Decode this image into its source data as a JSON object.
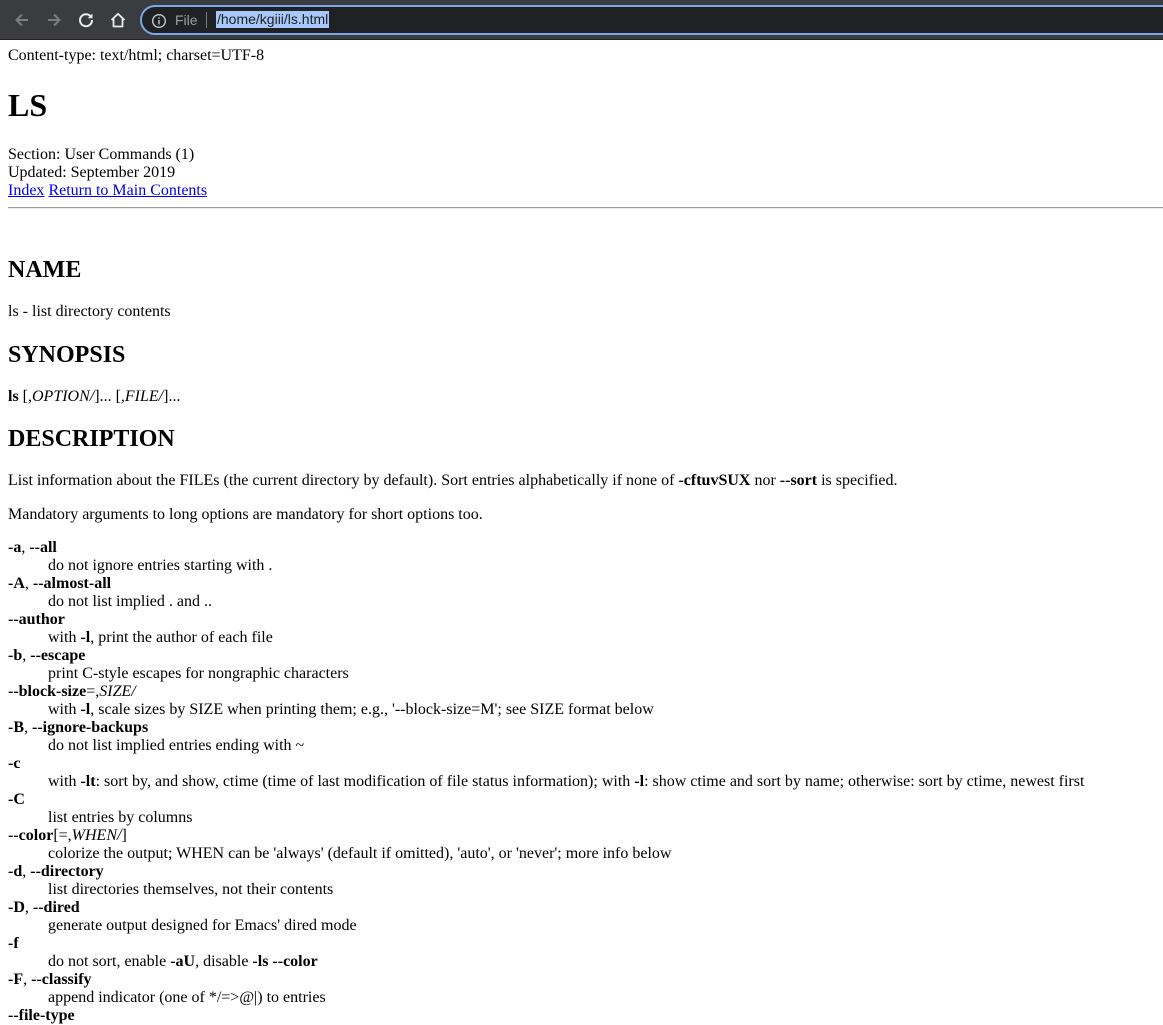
{
  "browser": {
    "back_icon": "arrow-left-icon",
    "forward_icon": "arrow-right-icon",
    "reload_icon": "reload-icon",
    "home_icon": "home-icon",
    "info_icon": "info-icon",
    "scheme_label": "File",
    "url": "/home/kgiii/ls.html",
    "colors": {
      "toolbar": "#3b3c3f",
      "omnibox_border": "#7ba7e8",
      "selection": "#a8c7fa"
    }
  },
  "doc": {
    "content_type": "Content-type: text/html; charset=UTF-8",
    "title": "LS",
    "section": "Section: User Commands (1)",
    "updated": "Updated: September 2019",
    "index_link": "Index",
    "main_link": "Return to Main Contents",
    "name_heading": "NAME",
    "name_text": "ls - list directory contents",
    "synopsis_heading": "SYNOPSIS",
    "synopsis": {
      "cmd": "ls",
      "p1": " [,",
      "opt": "OPTION/",
      "p2": "]... [,",
      "file": "FILE/",
      "p3": "]..."
    },
    "description_heading": "DESCRIPTION",
    "desc1": {
      "a": "List information about the FILEs (the current directory by default). Sort entries alphabetically if none of ",
      "b1": "-cftuvSUX",
      "c": " nor ",
      "b2": "--sort",
      "d": " is specified."
    },
    "desc2": "Mandatory arguments to long options are mandatory for short options too.",
    "options": [
      {
        "term": [
          [
            "b",
            "-a"
          ],
          [
            "t",
            ", "
          ],
          [
            "b",
            "--all"
          ]
        ],
        "desc": [
          [
            "t",
            "do not ignore entries starting with ."
          ]
        ]
      },
      {
        "term": [
          [
            "b",
            "-A"
          ],
          [
            "t",
            ", "
          ],
          [
            "b",
            "--almost-all"
          ]
        ],
        "desc": [
          [
            "t",
            "do not list implied . and .."
          ]
        ]
      },
      {
        "term": [
          [
            "b",
            "--author"
          ]
        ],
        "desc": [
          [
            "t",
            "with "
          ],
          [
            "b",
            "-l"
          ],
          [
            "t",
            ", print the author of each file"
          ]
        ]
      },
      {
        "term": [
          [
            "b",
            "-b"
          ],
          [
            "t",
            ", "
          ],
          [
            "b",
            "--escape"
          ]
        ],
        "desc": [
          [
            "t",
            "print C-style escapes for nongraphic characters"
          ]
        ]
      },
      {
        "term": [
          [
            "b",
            "--block-size"
          ],
          [
            "t",
            "=,"
          ],
          [
            "i",
            "SIZE/"
          ]
        ],
        "desc": [
          [
            "t",
            "with "
          ],
          [
            "b",
            "-l"
          ],
          [
            "t",
            ", scale sizes by SIZE when printing them; e.g., '--block-size=M'; see SIZE format below"
          ]
        ]
      },
      {
        "term": [
          [
            "b",
            "-B"
          ],
          [
            "t",
            ", "
          ],
          [
            "b",
            "--ignore-backups"
          ]
        ],
        "desc": [
          [
            "t",
            "do not list implied entries ending with ~"
          ]
        ]
      },
      {
        "term": [
          [
            "b",
            "-c"
          ]
        ],
        "desc": [
          [
            "t",
            "with "
          ],
          [
            "b",
            "-lt"
          ],
          [
            "t",
            ": sort by, and show, ctime (time of last modification of file status information); with "
          ],
          [
            "b",
            "-l"
          ],
          [
            "t",
            ": show ctime and sort by name; otherwise: sort by ctime, newest first"
          ]
        ]
      },
      {
        "term": [
          [
            "b",
            "-C"
          ]
        ],
        "desc": [
          [
            "t",
            "list entries by columns"
          ]
        ]
      },
      {
        "term": [
          [
            "b",
            "--color"
          ],
          [
            "t",
            "[=,"
          ],
          [
            "i",
            "WHEN/"
          ],
          [
            "t",
            "]"
          ]
        ],
        "desc": [
          [
            "t",
            "colorize the output; WHEN can be 'always' (default if omitted), 'auto', or 'never'; more info below"
          ]
        ]
      },
      {
        "term": [
          [
            "b",
            "-d"
          ],
          [
            "t",
            ", "
          ],
          [
            "b",
            "--directory"
          ]
        ],
        "desc": [
          [
            "t",
            "list directories themselves, not their contents"
          ]
        ]
      },
      {
        "term": [
          [
            "b",
            "-D"
          ],
          [
            "t",
            ", "
          ],
          [
            "b",
            "--dired"
          ]
        ],
        "desc": [
          [
            "t",
            "generate output designed for Emacs' dired mode"
          ]
        ]
      },
      {
        "term": [
          [
            "b",
            "-f"
          ]
        ],
        "desc": [
          [
            "t",
            "do not sort, enable "
          ],
          [
            "b",
            "-aU"
          ],
          [
            "t",
            ", disable "
          ],
          [
            "b",
            "-ls --color"
          ]
        ]
      },
      {
        "term": [
          [
            "b",
            "-F"
          ],
          [
            "t",
            ", "
          ],
          [
            "b",
            "--classify"
          ]
        ],
        "desc": [
          [
            "t",
            "append indicator (one of */=>@|) to entries"
          ]
        ]
      },
      {
        "term": [
          [
            "b",
            "--file-type"
          ]
        ],
        "desc": [
          [
            "t",
            ""
          ]
        ]
      }
    ]
  }
}
